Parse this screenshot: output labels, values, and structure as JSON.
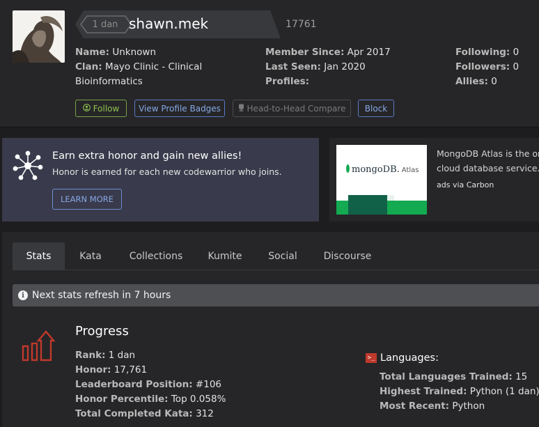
{
  "profile": {
    "rank": "1 dan",
    "username": "shawn.mek",
    "honor": "17761",
    "name_label": "Name:",
    "name": "Unknown",
    "clan_label": "Clan:",
    "clan_line1": "Mayo Clinic - Clinical",
    "clan_line2": "Bioinformatics",
    "member_since_label": "Member Since:",
    "member_since": "Apr 2017",
    "last_seen_label": "Last Seen:",
    "last_seen": "Jan 2020",
    "profiles_label": "Profiles:",
    "following_label": "Following:",
    "following": "0",
    "followers_label": "Followers:",
    "followers": "0",
    "allies_label": "Allies:",
    "allies": "0"
  },
  "actions": {
    "follow": "Follow",
    "view_badges": "View Profile Badges",
    "head_to_head": "Head-to-Head Compare",
    "block": "Block"
  },
  "promo": {
    "title": "Earn extra honor and gain new allies!",
    "subtitle": "Honor is earned for each new codewarrior who joins.",
    "button": "LEARN MORE"
  },
  "ad": {
    "logo_text": "mongoDB.",
    "logo_sub": "Atlas",
    "line1": "MongoDB Atlas is the or",
    "line2": "cloud database service. T",
    "via": "ads via Carbon"
  },
  "tabs": [
    {
      "label": "Stats"
    },
    {
      "label": "Kata"
    },
    {
      "label": "Collections"
    },
    {
      "label": "Kumite"
    },
    {
      "label": "Social"
    },
    {
      "label": "Discourse"
    }
  ],
  "notice": "Next stats refresh in 7 hours",
  "progress": {
    "title": "Progress",
    "rank_label": "Rank:",
    "rank": "1 dan",
    "honor_label": "Honor:",
    "honor": "17,761",
    "leaderboard_label": "Leaderboard Position:",
    "leaderboard": "#106",
    "percentile_label": "Honor Percentile:",
    "percentile": "Top 0.058%",
    "completed_label": "Total Completed Kata:",
    "completed": "312"
  },
  "languages": {
    "title": "Languages:",
    "trained_label": "Total Languages Trained:",
    "trained": "15",
    "highest_label": "Highest Trained:",
    "highest": "Python (1 dan)",
    "recent_label": "Most Recent:",
    "recent": "Python"
  },
  "colors": {
    "background": "#1d1d1f",
    "panel": "#262628",
    "promo": "#393a4b",
    "accent_blue": "#86a8e6",
    "follow_green": "#8ec24f",
    "progress_red": "#c0392b",
    "mongo_green": "#13aa52"
  }
}
